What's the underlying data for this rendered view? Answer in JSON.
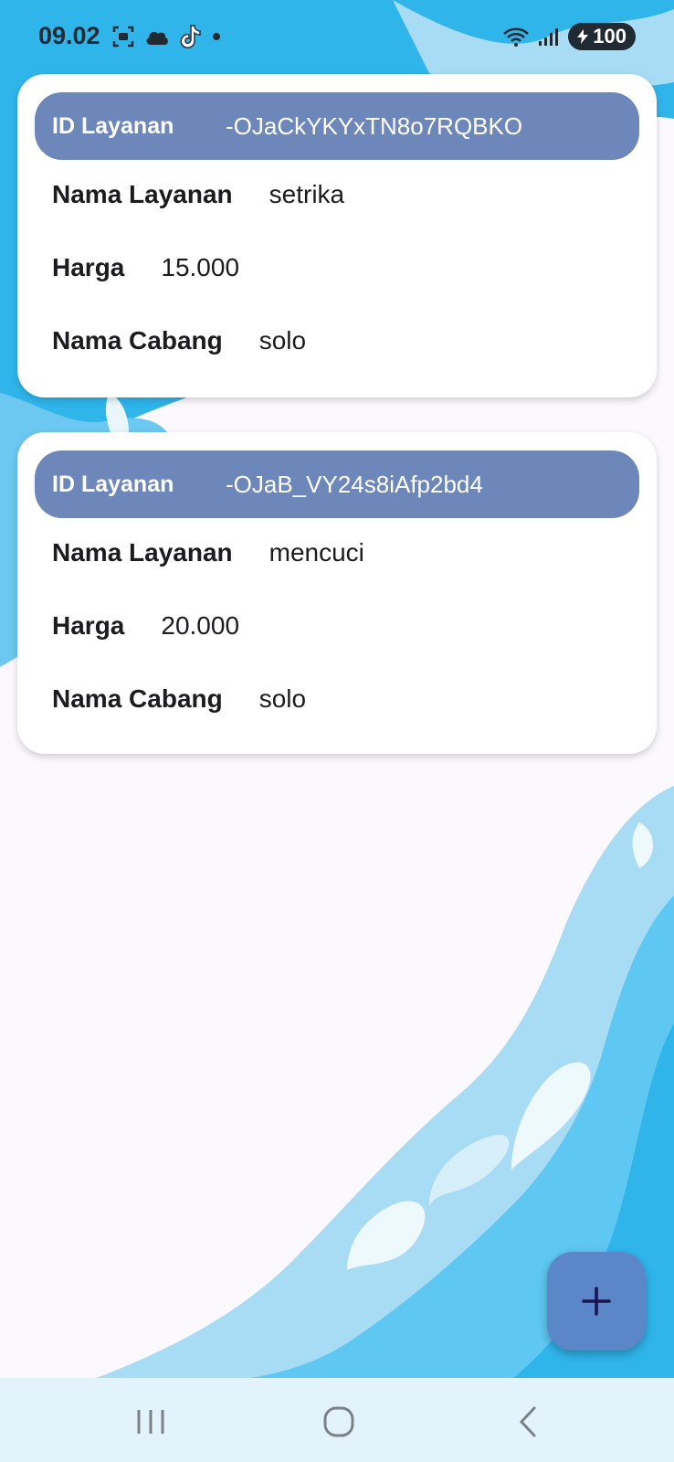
{
  "status_bar": {
    "time": "09.02",
    "battery": "100",
    "icons": [
      "screenshot-icon",
      "cloud-icon",
      "tiktok-icon",
      "dot-icon",
      "wifi-icon",
      "signal-icon",
      "battery-icon"
    ]
  },
  "labels": {
    "id": "ID Layanan",
    "nama_layanan": "Nama Layanan",
    "harga": "Harga",
    "nama_cabang": "Nama Cabang"
  },
  "items": [
    {
      "id": "-OJaCkYKYxTN8o7RQBKO",
      "nama_layanan": "setrika",
      "harga": "15.000",
      "nama_cabang": "solo"
    },
    {
      "id": "-OJaB_VY24s8iAfp2bd4",
      "nama_layanan": "mencuci",
      "harga": "20.000",
      "nama_cabang": "solo"
    }
  ],
  "fab": {
    "icon": "plus-icon",
    "color": "#5b87c9"
  },
  "nav_bar": {
    "icons": [
      "recent-apps-icon",
      "home-icon",
      "back-icon"
    ]
  },
  "colors": {
    "id_bar": "#6e87ba",
    "water_dark": "#2fb5ea",
    "water_light": "#a8dcf5"
  }
}
